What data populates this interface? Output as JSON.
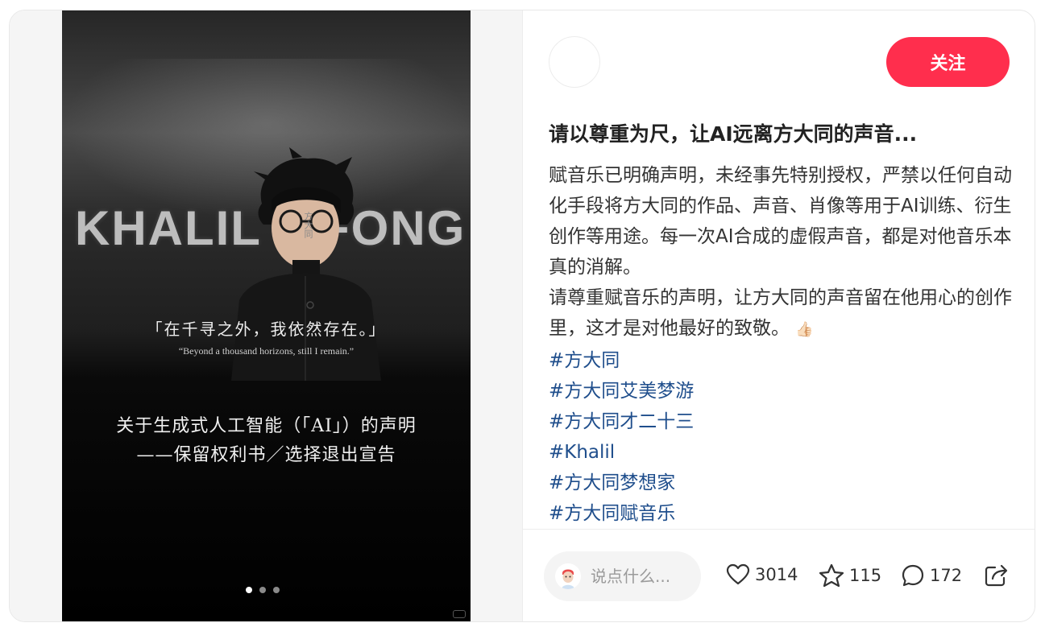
{
  "poster": {
    "bg_name_first": "KHALIL",
    "bg_name_last": "FONG",
    "vertical_cn": "方大同",
    "quote_cn": "「在千寻之外，我依然存在。」",
    "quote_en": "“Beyond a thousand horizons, still I remain.”",
    "statement_line1": "关于生成式人工智能（「AI」）的声明",
    "statement_line2": "——保留权利书／选择退出宣告",
    "carousel": {
      "total": 3,
      "active": 1
    }
  },
  "header": {
    "follow_label": "关注"
  },
  "post": {
    "title": "请以尊重为尺，让AI远离方大同的声音...",
    "body_p1": "赋音乐已明确声明，未经事先特别授权，严禁以任何自动化手段将方大同的作品、声音、肖像等用于AI训练、衍生创作等用途。每一次AI合成的虚假声音，都是对他音乐本真的消解。",
    "body_p2": "请尊重赋音乐的声明，让方大同的声音留在他用心的创作里，这才是对他最好的致敬。",
    "body_p2_emoji": "👍🏻",
    "hashtags": [
      "#方大同",
      "#方大同艾美梦游",
      "#方大同才二十三",
      "#Khalil",
      "#方大同梦想家",
      "#方大同赋音乐"
    ]
  },
  "actions": {
    "comment_placeholder": "说点什么...",
    "likes": "3014",
    "favorites": "115",
    "comments": "172",
    "icons": {
      "like": "heart-icon",
      "favorite": "star-icon",
      "comment": "comment-bubble-icon",
      "share": "share-icon"
    }
  },
  "colors": {
    "accent": "#ff2e4d",
    "hashtag": "#1f4e8c"
  }
}
